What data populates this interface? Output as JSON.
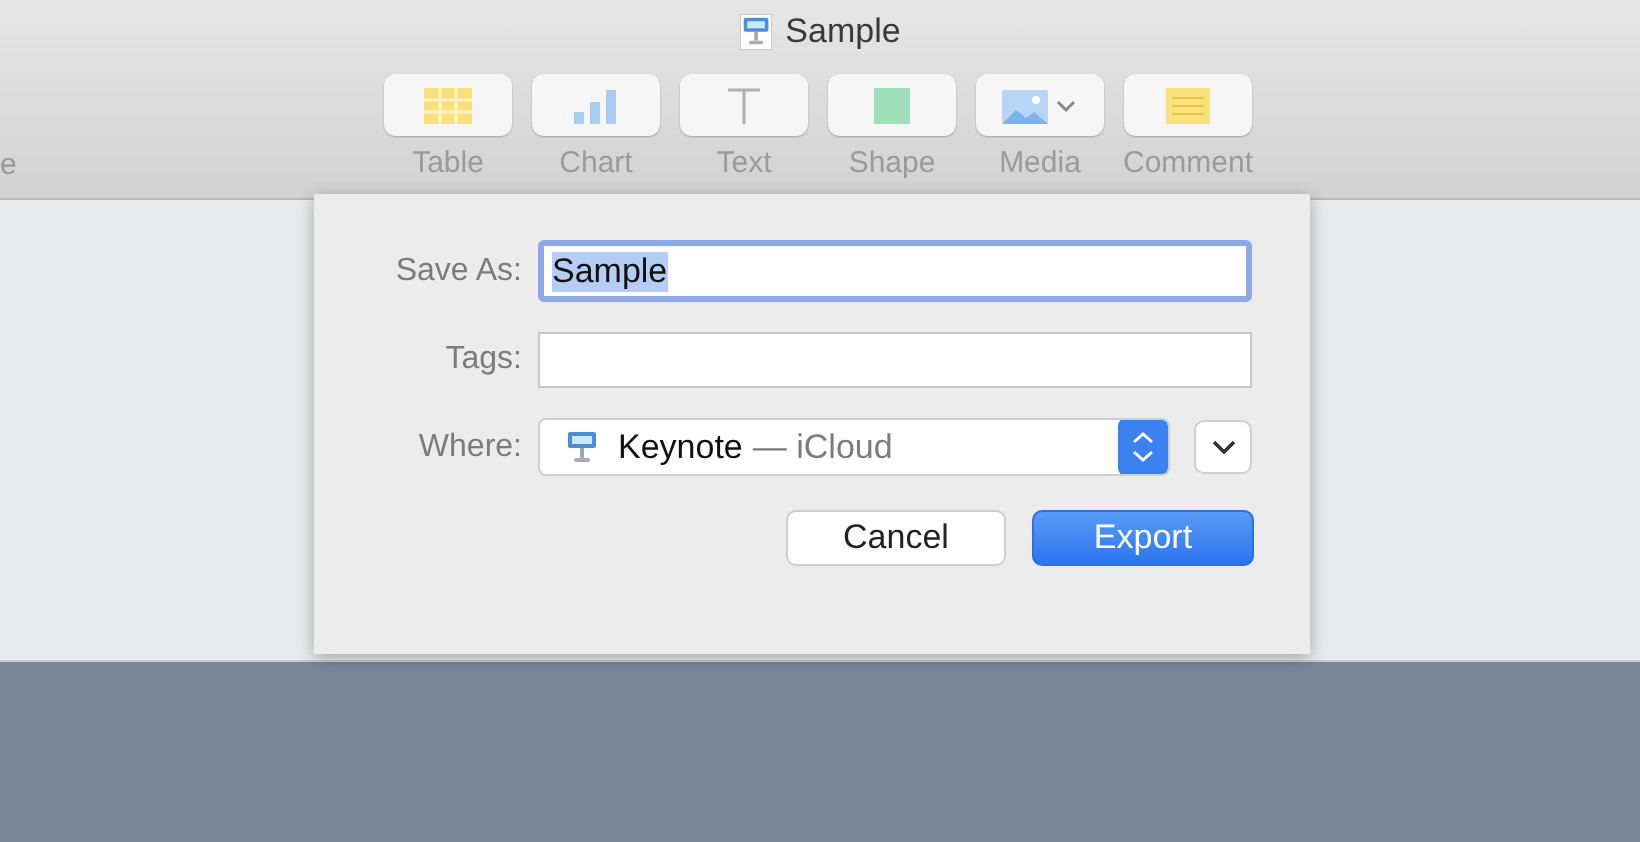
{
  "window": {
    "title": "Sample"
  },
  "toolbar": {
    "edge_label": "e",
    "items": [
      {
        "kind": "table",
        "label": "Table"
      },
      {
        "kind": "chart",
        "label": "Chart"
      },
      {
        "kind": "text",
        "label": "Text"
      },
      {
        "kind": "shape",
        "label": "Shape"
      },
      {
        "kind": "media",
        "label": "Media"
      },
      {
        "kind": "comment",
        "label": "Comment"
      }
    ]
  },
  "dialog": {
    "save_as": {
      "label": "Save As:",
      "value": "Sample",
      "focused": true,
      "text_selected": true
    },
    "tags": {
      "label": "Tags:"
    },
    "where": {
      "label": "Where:",
      "location": "Keynote",
      "service": "— iCloud"
    },
    "buttons": [
      {
        "label": "Cancel",
        "default": false
      },
      {
        "label": "Export",
        "default": true
      }
    ]
  }
}
